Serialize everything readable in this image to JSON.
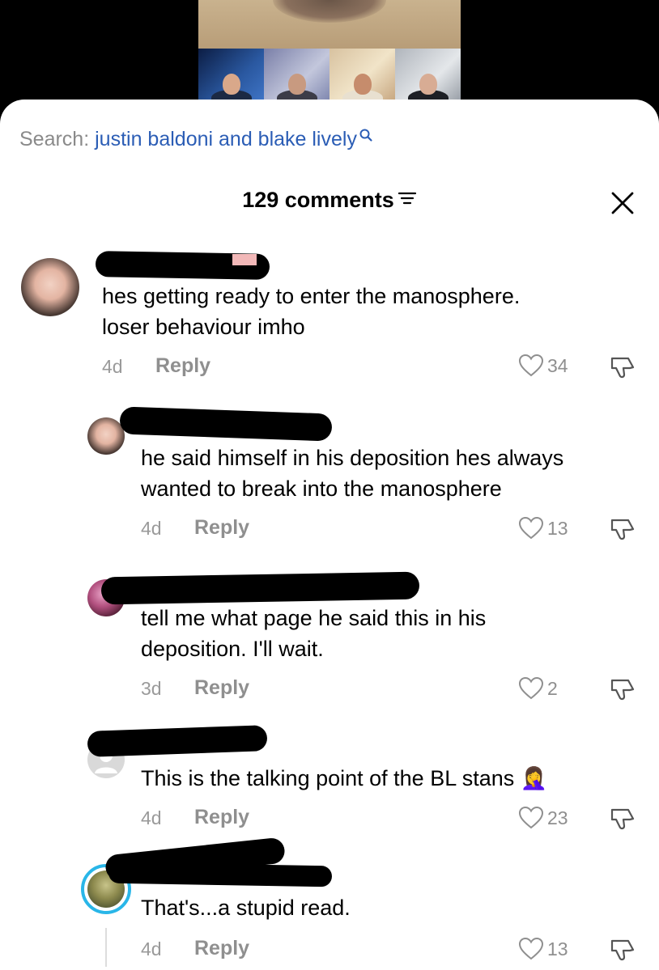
{
  "search": {
    "label": "Search:",
    "query": "justin baldoni and blake lively"
  },
  "header": {
    "comment_count": "129 comments"
  },
  "comments": [
    {
      "text_lines": [
        "hes getting ready to enter the manosphere.",
        "loser behaviour imho"
      ],
      "time": "4d",
      "reply_label": "Reply",
      "likes": "34"
    },
    {
      "text_lines": [
        "he said himself in his deposition hes always",
        "wanted to break into the manosphere"
      ],
      "time": "4d",
      "reply_label": "Reply",
      "likes": "13"
    },
    {
      "text_lines": [
        "tell me what page he said this in his",
        "deposition. I'll wait."
      ],
      "time": "3d",
      "reply_label": "Reply",
      "likes": "2"
    },
    {
      "text_lines": [
        "This is the talking point of the BL stans 🤦‍♀️"
      ],
      "time": "4d",
      "reply_label": "Reply",
      "likes": "23"
    },
    {
      "text_lines": [
        "That's...a stupid read."
      ],
      "time": "4d",
      "reply_label": "Reply",
      "likes": "13"
    }
  ],
  "colors": {
    "link_blue": "#2b5db5",
    "meta_gray": "#8f8f8f",
    "story_ring": "#29b6e8"
  },
  "icons": [
    "search-icon",
    "filter-icon",
    "close-icon",
    "heart-icon",
    "dislike-icon",
    "facepalm-emoji"
  ]
}
